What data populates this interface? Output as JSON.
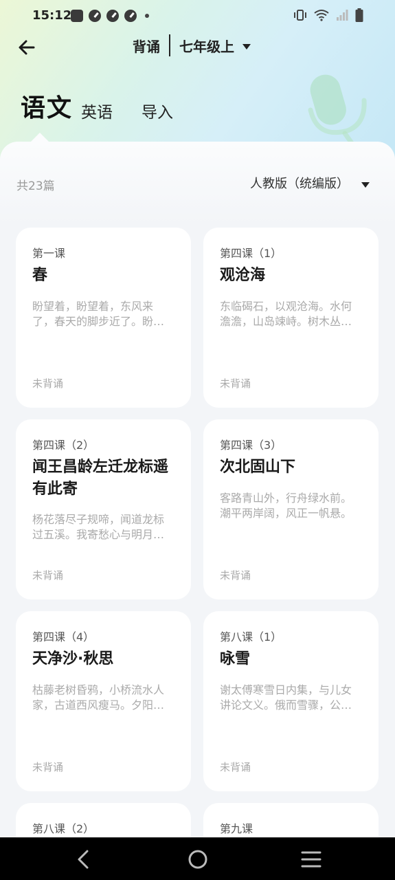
{
  "status_bar": {
    "time": "15:12",
    "left_icons": [
      "notification-bag-icon",
      "gauge-icon",
      "gauge-icon",
      "gauge-icon",
      "dot-icon"
    ],
    "right_icons": [
      "vibrate-icon",
      "wifi-icon",
      "signal-icon",
      "battery-icon"
    ]
  },
  "topbar": {
    "mode": "背诵",
    "grade": "七年级上"
  },
  "subjects": {
    "active": "语文",
    "items": [
      "英语",
      "导入"
    ]
  },
  "list_header": {
    "count": "共23篇",
    "edition": "人教版（统编版）"
  },
  "cards": [
    {
      "lesson": "第一课",
      "title": "春",
      "excerpt": "盼望着，盼望着，东风来了，春天的脚步近了。盼望着，盼望着，东风来了，春天的脚步近了。",
      "status": "未背诵"
    },
    {
      "lesson": "第四课（1）",
      "title": "观沧海",
      "excerpt": "东临碣石，以观沧海。水何澹澹，山岛竦峙。树木丛生，百草丰茂。",
      "status": "未背诵"
    },
    {
      "lesson": "第四课（2）",
      "title": "闻王昌龄左迁龙标遥有此寄",
      "excerpt": "杨花落尽子规啼，闻道龙标过五溪。我寄愁心与明月，随君直到夜郎西。",
      "status": "未背诵"
    },
    {
      "lesson": "第四课（3）",
      "title": "次北固山下",
      "excerpt": "客路青山外，行舟绿水前。潮平两岸阔，风正一帆悬。",
      "status": "未背诵"
    },
    {
      "lesson": "第四课（4）",
      "title": "天净沙·秋思",
      "excerpt": "枯藤老树昏鸦，小桥流水人家，古道西风瘦马。夕阳西下，断肠人在天涯。",
      "status": "未背诵"
    },
    {
      "lesson": "第八课（1）",
      "title": "咏雪",
      "excerpt": "谢太傅寒雪日内集，与儿女讲论文义。俄而雪骤，公欣然曰。",
      "status": "未背诵"
    },
    {
      "lesson": "第八课（2）",
      "title": "",
      "excerpt": "",
      "status": ""
    },
    {
      "lesson": "第九课",
      "title": "",
      "excerpt": "",
      "status": ""
    }
  ],
  "navbar": {
    "items": [
      "back-nav-icon",
      "home-nav-icon",
      "recents-nav-icon"
    ]
  },
  "colors": {
    "header_gradient_start": "#ecf7d6",
    "header_gradient_end": "#c4e7f6",
    "page_background": "#f3f5f8",
    "card_background": "#ffffff",
    "muted_text": "#aaaaaa"
  }
}
